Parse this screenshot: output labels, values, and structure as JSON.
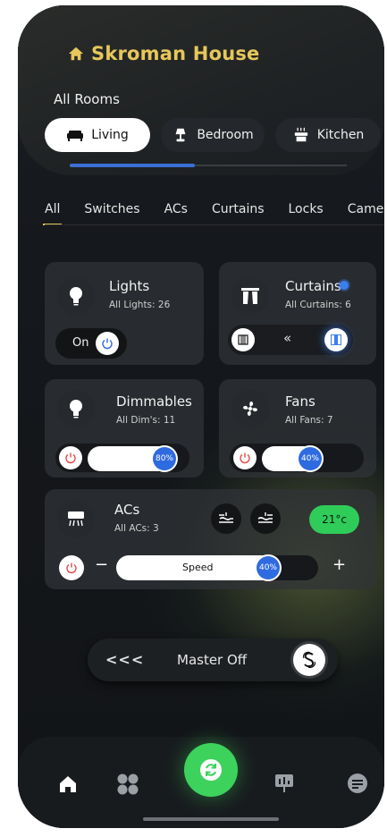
{
  "brand": {
    "title": "Skroman House",
    "color": "#e7c75a"
  },
  "rooms": {
    "heading": "All Rooms",
    "tabs": [
      {
        "label": "Living",
        "icon": "sofa-icon",
        "active": true
      },
      {
        "label": "Bedroom",
        "icon": "lamp-icon",
        "active": false
      },
      {
        "label": "Kitchen",
        "icon": "stove-icon",
        "active": false
      }
    ],
    "scroll_position": 0.45
  },
  "categories": [
    "All",
    "Switches",
    "ACs",
    "Curtains",
    "Locks",
    "Camera"
  ],
  "cards": {
    "lights": {
      "title": "Lights",
      "subtitle": "All Lights: 26",
      "toggle_label": "On"
    },
    "curtains": {
      "title": "Curtains",
      "subtitle": "All Curtains: 6",
      "open_symbol": "«"
    },
    "dimmables": {
      "title": "Dimmables",
      "subtitle": "All Dim's: 11",
      "level": "80%",
      "level_value": 80
    },
    "fans": {
      "title": "Fans",
      "subtitle": "All Fans: 7",
      "level": "40%",
      "level_value": 40
    },
    "acs": {
      "title": "ACs",
      "subtitle": "All ACs: 3",
      "temperature": "21°c",
      "minus": "−",
      "plus": "+",
      "speed_label": "Speed",
      "speed": "40%",
      "speed_value": 40
    }
  },
  "master": {
    "arrows": "<<<",
    "label": "Master Off"
  },
  "colors": {
    "accent_blue": "#2f6be0",
    "accent_green": "#3dd25c",
    "power_red": "#e24a4a"
  }
}
